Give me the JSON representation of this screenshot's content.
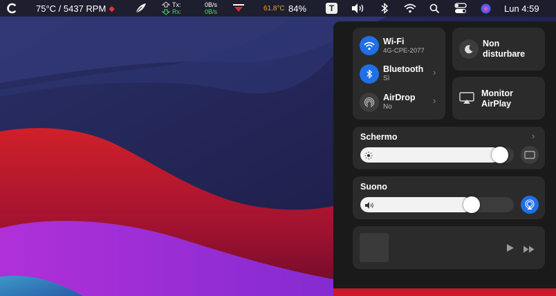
{
  "menubar": {
    "temp_rpm": "75°C / 5437 RPM",
    "tx_label": "Tx:",
    "rx_label": "Rx:",
    "tx_value": "0B/s",
    "rx_value": "0B/s",
    "cpu_temp": "61.8°C",
    "battery": "84%",
    "t_icon_label": "T",
    "datetime": "Lun 4:59",
    "accent_orange": "#f0a030",
    "accent_green": "#4cd964"
  },
  "control_center": {
    "wifi": {
      "title": "Wi-Fi",
      "subtitle": "4G-CPE-2077"
    },
    "bluetooth": {
      "title": "Bluetooth",
      "subtitle": "Sì"
    },
    "airdrop": {
      "title": "AirDrop",
      "subtitle": "No"
    },
    "dnd": {
      "title_line1": "Non",
      "title_line2": "disturbare"
    },
    "airplay": {
      "title_line1": "Monitor",
      "title_line2": "AirPlay"
    },
    "display": {
      "title": "Schermo",
      "brightness": 0.96
    },
    "sound": {
      "title": "Suono",
      "volume": 0.75
    },
    "accent_blue": "#1f6fe6"
  }
}
